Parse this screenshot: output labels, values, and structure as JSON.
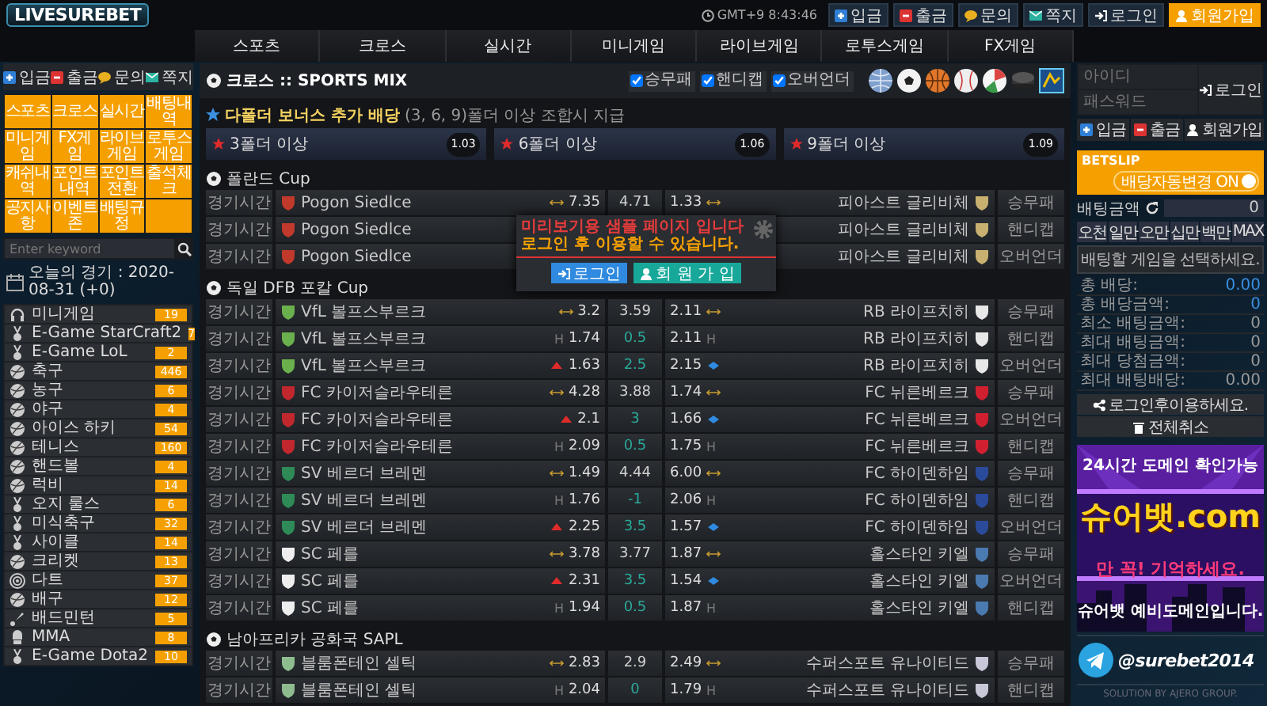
{
  "header": {
    "logo": "LIVESUREBET",
    "clock": "GMT+9 8:43:46",
    "actions": [
      {
        "label": "입금",
        "kind": "deposit"
      },
      {
        "label": "출금",
        "kind": "withdraw"
      },
      {
        "label": "문의",
        "kind": "inquiry"
      },
      {
        "label": "쪽지",
        "kind": "message"
      }
    ],
    "login": "로그인",
    "join": "회원가입"
  },
  "nav": [
    "스포츠",
    "크로스",
    "실시간",
    "미니게임",
    "라이브게임",
    "로투스게임",
    "FX게임"
  ],
  "sidebar": {
    "actions": [
      {
        "label": "입금",
        "kind": "deposit"
      },
      {
        "label": "출금",
        "kind": "withdraw"
      },
      {
        "label": "문의",
        "kind": "inquiry"
      },
      {
        "label": "쪽지",
        "kind": "message"
      }
    ],
    "menu": [
      "스포츠",
      "크로스",
      "실시간",
      "배팅내역",
      "미니게임",
      "FX게임",
      "라이브게임",
      "로투스게임",
      "캐쉬내역",
      "포인트내역",
      "포인트전환",
      "출석체크",
      "공지사항",
      "이벤트존",
      "배팅규정"
    ],
    "search": {
      "placeholder": "Enter keyword"
    },
    "today": "오늘의 경기 : 2020-08-31 (+0)",
    "sports": [
      {
        "name": "미니게임",
        "count": "19",
        "kind": "minigame"
      },
      {
        "name": "E-Game StarCraft2",
        "count": "7",
        "kind": "esports"
      },
      {
        "name": "E-Game LoL",
        "count": "2",
        "kind": "esports"
      },
      {
        "name": "축구",
        "count": "446",
        "kind": "ball"
      },
      {
        "name": "농구",
        "count": "6",
        "kind": "ball"
      },
      {
        "name": "야구",
        "count": "4",
        "kind": "ball"
      },
      {
        "name": "아이스 하키",
        "count": "54",
        "kind": "ball"
      },
      {
        "name": "테니스",
        "count": "160",
        "kind": "ball"
      },
      {
        "name": "핸드볼",
        "count": "4",
        "kind": "ball"
      },
      {
        "name": "럭비",
        "count": "14",
        "kind": "ball"
      },
      {
        "name": "오지 룰스",
        "count": "6",
        "kind": "esports"
      },
      {
        "name": "미식축구",
        "count": "32",
        "kind": "esports"
      },
      {
        "name": "사이클",
        "count": "14",
        "kind": "esports"
      },
      {
        "name": "크리켓",
        "count": "13",
        "kind": "ball"
      },
      {
        "name": "다트",
        "count": "37",
        "kind": "target"
      },
      {
        "name": "배구",
        "count": "12",
        "kind": "ball"
      },
      {
        "name": "배드민턴",
        "count": "5",
        "kind": "shuttlecock"
      },
      {
        "name": "MMA",
        "count": "8",
        "kind": "fighting"
      },
      {
        "name": "E-Game Dota2",
        "count": "10",
        "kind": "esports"
      }
    ]
  },
  "board": {
    "title": "크로스 :: SPORTS MIX",
    "filters": [
      {
        "label": "승무패",
        "checked": true
      },
      {
        "label": "핸디캡",
        "checked": true
      },
      {
        "label": "오버언더",
        "checked": true
      }
    ],
    "bonus": {
      "title": "다폴더 보너스 추가 배당",
      "note": "(3, 6, 9)폴더 이상 조합시 지급",
      "tiers": [
        {
          "label": "3폴더 이상",
          "odds": "1.03"
        },
        {
          "label": "6폴더 이상",
          "odds": "1.06"
        },
        {
          "label": "9폴더 이상",
          "odds": "1.09"
        }
      ]
    },
    "leagues": [
      {
        "name": "폴란드 Cup",
        "rows": [
          {
            "kind": "match",
            "time": "경기시간",
            "home": {
              "name": "Pogon Siedlce",
              "color": "#c0392b"
            },
            "home_odds": "7.35",
            "mid": "4.71",
            "away_odds": "1.33",
            "away": {
              "name": "피아스트 글리비체",
              "color": "#c8b070"
            },
            "type": "승무패"
          },
          {
            "kind": "handicap",
            "time": "경기시간",
            "home": {
              "name": "Pogon Siedlce",
              "color": "#c0392b"
            },
            "away": {
              "name": "피아스트 글리비체",
              "color": "#c8b070"
            },
            "type": "핸디캡"
          },
          {
            "kind": "overunder",
            "time": "경기시간",
            "home": {
              "name": "Pogon Siedlce",
              "color": "#c0392b"
            },
            "away": {
              "name": "피아스트 글리비체",
              "color": "#c8b070"
            },
            "type": "오버언더"
          }
        ]
      },
      {
        "name": "독일 DFB 포칼 Cup",
        "rows": [
          {
            "kind": "match",
            "time": "경기시간",
            "home": {
              "name": "VfL 볼프스부르크",
              "color": "#6ab04c"
            },
            "home_odds": "3.2",
            "mid": "3.59",
            "away_odds": "2.11",
            "away": {
              "name": "RB 라이프치히",
              "color": "#e8e8e8"
            },
            "type": "승무패"
          },
          {
            "kind": "handicap",
            "time": "경기시간",
            "home": {
              "name": "VfL 볼프스부르크",
              "color": "#6ab04c"
            },
            "home_mark": "H",
            "home_odds": "1.74",
            "mid": "0.5",
            "away_odds": "2.11",
            "away_mark": "H",
            "away": {
              "name": "RB 라이프치히",
              "color": "#e8e8e8"
            },
            "type": "핸디캡"
          },
          {
            "kind": "overunder",
            "time": "경기시간",
            "home": {
              "name": "VfL 볼프스부르크",
              "color": "#6ab04c"
            },
            "home_odds": "1.63",
            "mid": "2.5",
            "away_odds": "2.15",
            "away": {
              "name": "RB 라이프치히",
              "color": "#e8e8e8"
            },
            "type": "오버언더"
          },
          {
            "kind": "match",
            "time": "경기시간",
            "home": {
              "name": "FC 카이저슬라우테른",
              "color": "#c0282d"
            },
            "home_odds": "4.28",
            "mid": "3.88",
            "away_odds": "1.74",
            "away": {
              "name": "FC 뉘른베르크",
              "color": "#d02030"
            },
            "type": "승무패"
          },
          {
            "kind": "overunder",
            "time": "경기시간",
            "home": {
              "name": "FC 카이저슬라우테른",
              "color": "#c0282d"
            },
            "home_odds": "2.1",
            "mid": "3",
            "away_odds": "1.66",
            "away": {
              "name": "FC 뉘른베르크",
              "color": "#d02030"
            },
            "type": "오버언더"
          },
          {
            "kind": "handicap",
            "time": "경기시간",
            "home": {
              "name": "FC 카이저슬라우테른",
              "color": "#c0282d"
            },
            "home_mark": "H",
            "home_odds": "2.09",
            "mid": "0.5",
            "away_odds": "1.75",
            "away_mark": "H",
            "away": {
              "name": "FC 뉘른베르크",
              "color": "#d02030"
            },
            "type": "핸디캡"
          },
          {
            "kind": "match",
            "time": "경기시간",
            "home": {
              "name": "SV 베르더 브레멘",
              "color": "#2e8b57"
            },
            "home_odds": "1.49",
            "mid": "4.44",
            "away_odds": "6.00",
            "away": {
              "name": "FC 하이덴하임",
              "color": "#2a4a9a"
            },
            "type": "승무패"
          },
          {
            "kind": "handicap",
            "time": "경기시간",
            "home": {
              "name": "SV 베르더 브레멘",
              "color": "#2e8b57"
            },
            "home_mark": "H",
            "home_odds": "1.76",
            "mid": "-1",
            "away_odds": "2.06",
            "away_mark": "H",
            "away": {
              "name": "FC 하이덴하임",
              "color": "#2a4a9a"
            },
            "type": "핸디캡"
          },
          {
            "kind": "overunder",
            "time": "경기시간",
            "home": {
              "name": "SV 베르더 브레멘",
              "color": "#2e8b57"
            },
            "home_odds": "2.25",
            "mid": "3.5",
            "away_odds": "1.57",
            "away": {
              "name": "FC 하이덴하임",
              "color": "#2a4a9a"
            },
            "type": "오버언더"
          },
          {
            "kind": "match",
            "time": "경기시간",
            "home": {
              "name": "SC 페를",
              "color": "#eeeeee"
            },
            "home_odds": "3.78",
            "mid": "3.77",
            "away_odds": "1.87",
            "away": {
              "name": "홀스타인 키엘",
              "color": "#4a7ab0"
            },
            "type": "승무패"
          },
          {
            "kind": "overunder",
            "time": "경기시간",
            "home": {
              "name": "SC 페를",
              "color": "#eeeeee"
            },
            "home_odds": "2.31",
            "mid": "3.5",
            "away_odds": "1.54",
            "away": {
              "name": "홀스타인 키엘",
              "color": "#4a7ab0"
            },
            "type": "오버언더"
          },
          {
            "kind": "handicap",
            "time": "경기시간",
            "home": {
              "name": "SC 페를",
              "color": "#eeeeee"
            },
            "home_mark": "H",
            "home_odds": "1.94",
            "mid": "0.5",
            "away_odds": "1.87",
            "away_mark": "H",
            "away": {
              "name": "홀스타인 키엘",
              "color": "#4a7ab0"
            },
            "type": "핸디캡"
          }
        ]
      },
      {
        "name": "남아프리카 공화국 SAPL",
        "rows": [
          {
            "kind": "match",
            "time": "경기시간",
            "home": {
              "name": "블룸폰테인 셀틱",
              "color": "#8fbc8f"
            },
            "home_odds": "2.83",
            "mid": "2.9",
            "away_odds": "2.49",
            "away": {
              "name": "수퍼스포트 유나이티드",
              "color": "#c8c8d8"
            },
            "type": "승무패"
          },
          {
            "kind": "handicap",
            "time": "경기시간",
            "home": {
              "name": "블룸폰테인 셀틱",
              "color": "#8fbc8f"
            },
            "home_mark": "H",
            "home_odds": "2.04",
            "mid": "0",
            "away_odds": "1.79",
            "away_mark": "H",
            "away": {
              "name": "수퍼스포트 유나이티드",
              "color": "#c8c8d8"
            },
            "type": "핸디캡"
          }
        ]
      }
    ]
  },
  "modal": {
    "lines": [
      "미리보기용 샘플 페이지 입니다",
      "로그인 후 이용할 수 있습니다."
    ],
    "buttons": [
      {
        "label": "로그인",
        "kind": "login"
      },
      {
        "label": "회 원 가 입",
        "kind": "join"
      }
    ]
  },
  "account": {
    "id_placeholder": "아이디",
    "pw_placeholder": "패스워드",
    "login": "로그인",
    "actions": [
      {
        "label": "입금",
        "kind": "deposit"
      },
      {
        "label": "출금",
        "kind": "withdraw"
      },
      {
        "label": "회원가입",
        "kind": "join"
      }
    ]
  },
  "betslip": {
    "title": "BETSLIP",
    "auto_odds": {
      "label": "배당자동변경 ON",
      "on": true
    },
    "amount_label": "배팅금액",
    "amount": "0",
    "quick": [
      "오천",
      "일만",
      "오만",
      "십만",
      "백만",
      "MAX"
    ],
    "message": "배팅할 게임을 선택하세요.",
    "summary": [
      {
        "label": "총 배당:",
        "value": "0.00",
        "highlight": true
      },
      {
        "label": "총 배당금액:",
        "value": "0",
        "highlight": true
      },
      {
        "label": "최소 배팅금액:",
        "value": "0",
        "highlight": false
      },
      {
        "label": "최대 배팅금액:",
        "value": "0",
        "highlight": false
      },
      {
        "label": "최대 당첨금액:",
        "value": "0",
        "highlight": false
      },
      {
        "label": "최대 배팅배당:",
        "value": "0.00",
        "highlight": false
      }
    ],
    "buttons": [
      {
        "label": "로그인후이용하세요.",
        "kind": "share"
      },
      {
        "label": "전체취소",
        "kind": "trash"
      }
    ]
  },
  "banner": {
    "lines": [
      "24시간 도메인 확인가능",
      "슈어뱃.com",
      "만 꼭! 기억하세요.",
      "슈어뱃 예비도메인입니다."
    ]
  },
  "telegram": "@surebet2014",
  "credit": "SOLUTION BY AJERO GROUP."
}
